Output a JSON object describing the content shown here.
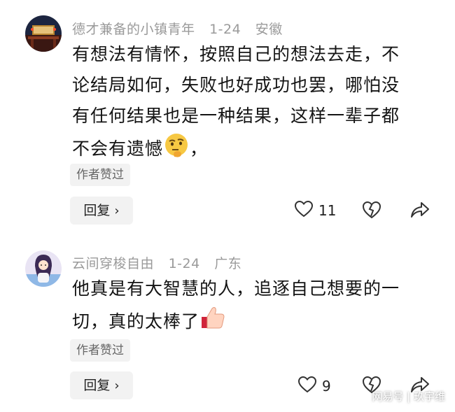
{
  "comments": [
    {
      "author": "德才兼备的小镇青年",
      "date": "1-24",
      "location": "安徽",
      "lines": [
        "有想法有情怀，按照自己的想法去走，不",
        "论结局如何，失败也好成功也罢，哪怕没",
        "有任何结果也是一种结果，这样一辈子都",
        "不会有遗憾"
      ],
      "tail": "，",
      "emoji": "thinking-face-emoji",
      "author_liked": "作者赞过",
      "reply_label": "回复",
      "likes": "11"
    },
    {
      "author": "云间穿梭自由",
      "date": "1-24",
      "location": "广东",
      "lines": [
        "他真是有大智慧的人，追逐自己想要的一",
        "切，真的太棒了"
      ],
      "emoji": "thumbs-up-emoji",
      "author_liked": "作者赞过",
      "reply_label": "回复",
      "likes": "9"
    }
  ],
  "icons": {
    "like": "heart-outline-icon",
    "dislike": "broken-heart-icon",
    "share": "share-arrow-icon"
  },
  "watermark": "网易号 | 玖宇维"
}
